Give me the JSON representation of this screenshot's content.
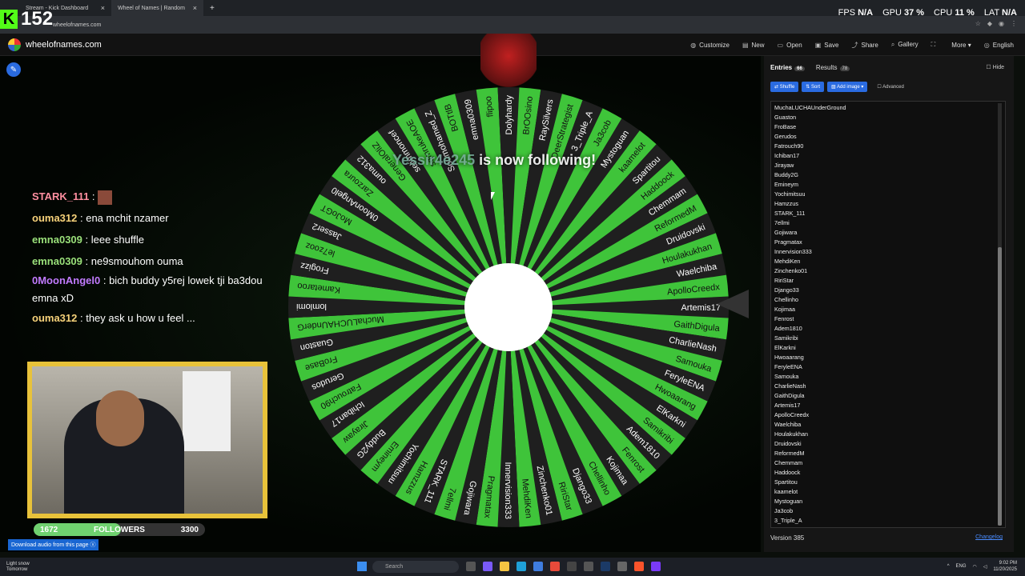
{
  "browser": {
    "tabs": [
      {
        "title": "Stream - Kick Dashboard",
        "active": false
      },
      {
        "title": "Wheel of Names | Random",
        "active": true
      }
    ],
    "address": "wheelofnames.com"
  },
  "overlay": {
    "viewer_count": "152",
    "fps_label": "FPS",
    "fps_value": "N/A",
    "gpu_label": "GPU",
    "gpu_value": "37 %",
    "cpu_label": "CPU",
    "cpu_value": "11 %",
    "lat_label": "LAT",
    "lat_value": "N/A",
    "follow_alert_name": "Yessir4e245",
    "follow_alert_text": "is now following!"
  },
  "site": {
    "name": "wheelofnames.com",
    "menu": [
      {
        "label": "Customize",
        "icon": "palette-icon"
      },
      {
        "label": "New",
        "icon": "file-icon"
      },
      {
        "label": "Open",
        "icon": "folder-icon"
      },
      {
        "label": "Save",
        "icon": "save-icon"
      },
      {
        "label": "Share",
        "icon": "share-icon"
      },
      {
        "label": "Gallery",
        "icon": "search-icon"
      },
      {
        "label": "",
        "icon": "fullscreen-icon"
      },
      {
        "label": "More",
        "icon": "chevron-down-icon"
      },
      {
        "label": "English",
        "icon": "globe-icon"
      }
    ]
  },
  "chat": [
    {
      "user": "STARK_111",
      "color": "#ff8fa0",
      "text": ""
    },
    {
      "user": "ouma312",
      "color": "#f7d27a",
      "text": "ena mchit nzamer"
    },
    {
      "user": "emna0309",
      "color": "#9ae07a",
      "text": "leee shuffle"
    },
    {
      "user": "emna0309",
      "color": "#9ae07a",
      "text": "ne9smouhom ouma"
    },
    {
      "user": "0MoonAngel0",
      "color": "#c27bff",
      "text": "bich buddy y5rej lowek tji ba3dou emna xD"
    },
    {
      "user": "ouma312",
      "color": "#f7d27a",
      "text": "they ask u how u feel ..."
    }
  ],
  "followers": {
    "current": "1672",
    "label": "FOLLOWERS",
    "goal": "3300",
    "progress": 0.51
  },
  "download_label": "Download audio from this page",
  "wheel": {
    "names": [
      "Artemis17",
      "GaithDigula",
      "CharlieNash",
      "Samouka",
      "FeryleENA",
      "Hwoaarang",
      "ElKarkni",
      "Samikribi",
      "Adem1810",
      "Fenrost",
      "Kojimaa",
      "Chellinho",
      "Django33",
      "RiriStar",
      "Zinchenko01",
      "MehdiKen",
      "Innervision333",
      "Pragmatax",
      "Gojiwara",
      "7ellmi",
      "STARK_111",
      "Hamzzus",
      "Yochimitsuu",
      "Emineym",
      "Buddy2G",
      "Jirayaw",
      "Ichiban17",
      "Fatrouch90",
      "Gerudos",
      "FroBase",
      "Guaston",
      "MuchaLUCHAUnderG",
      "lomlomi",
      "Kametaroo",
      "Frogizz",
      "le7zooz",
      "Jasser2",
      "MoJoGT",
      "0MoonAngel0",
      "Zarzoura",
      "oumа312",
      "GeneralOliZ",
      "selimmoncef",
      "sqmrukeAOE",
      "Soumohamed_Z",
      "BOTtlB",
      "emna0309",
      "flipoo",
      "Dolyhardy",
      "BrOOsino",
      "RaySilvers",
      "DeerStrategist",
      "3_Triple_A",
      "Ja3cob",
      "Mystoguan",
      "kaamelot",
      "Spartitou",
      "Haddoock",
      "Chemmam",
      "ReformedM",
      "Druidovski",
      "Houlakukhan",
      "Waelchiba",
      "ApolloCreedx"
    ]
  },
  "panel": {
    "tab_entries": "Entries",
    "entries_count": "66",
    "tab_results": "Results",
    "results_count": "78",
    "hide_label": "Hide",
    "shuffle_label": "Shuffle",
    "sort_label": "Sort",
    "add_image_label": "Add image",
    "advanced_label": "Advanced",
    "entries": [
      "MuchaLUCHAUnderGround",
      "Guaston",
      "FroBase",
      "Gerudos",
      "Fatrouch90",
      "Ichiban17",
      "Jirayaw",
      "Buddy2G",
      "Emineym",
      "Yochimitsuu",
      "Hamzzus",
      "STARK_111",
      "7ellmi",
      "Gojiwara",
      "Pragmatax",
      "Innervision333",
      "MehdiKen",
      "Zinchenko01",
      "RiriStar",
      "Django33",
      "Chellinho",
      "Kojimaa",
      "Fenrost",
      "Adem1810",
      "Samikribi",
      "ElKarkni",
      "Hwoaarang",
      "FeryleENA",
      "Samouka",
      "CharlieNash",
      "GaithDigula",
      "Artemis17",
      "ApolloCreedx",
      "Waelchiba",
      "Houlakukhan",
      "Druidovski",
      "ReformedM",
      "Chemmam",
      "Haddoock",
      "Spartitou",
      "kaamelot",
      "Mystoguan",
      "Ja3cob",
      "3_Triple_A"
    ],
    "version": "Version 385",
    "changelog": "Changelog"
  },
  "taskbar": {
    "weather_line1": "Light snow",
    "weather_line2": "Tomorrow",
    "search_placeholder": "Search",
    "lang": "ENG",
    "time": "9:02 PM",
    "date": "11/20/2025"
  }
}
